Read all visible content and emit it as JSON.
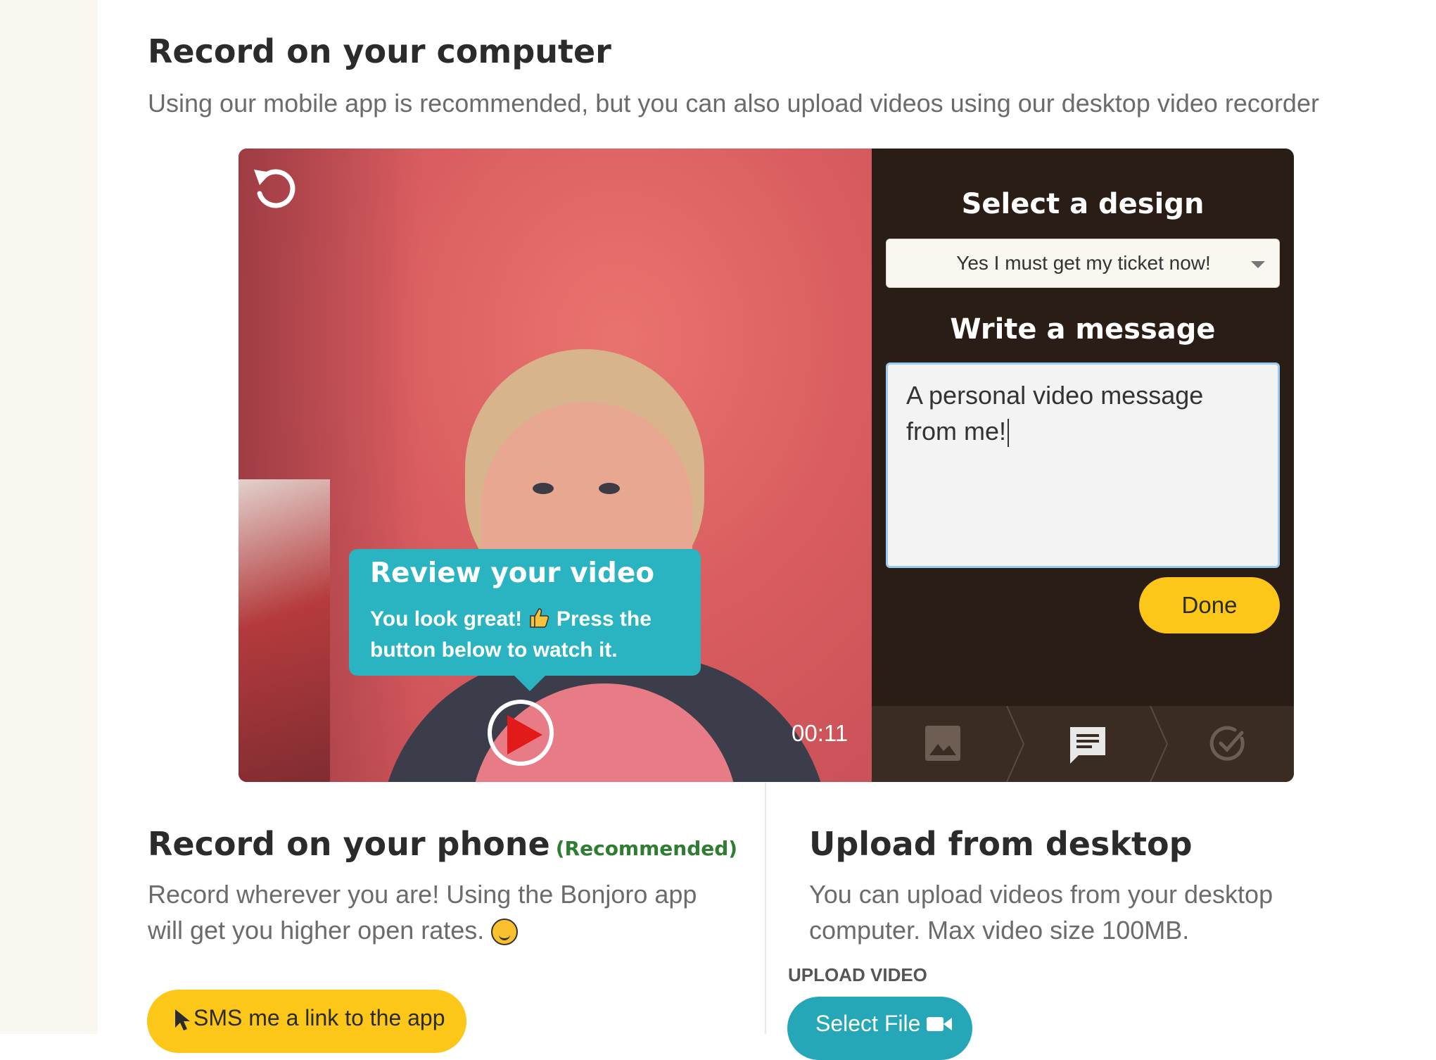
{
  "computer_section": {
    "title": "Record on your computer",
    "subtitle": "Using our mobile app is recommended, but you can also upload videos using our desktop video recorder"
  },
  "recorder": {
    "review_bubble": {
      "title": "Review your video",
      "text_before_icon": "You look great!",
      "thumb_icon": "thumbs-up-icon",
      "text_after_icon": "Press the button below to watch it."
    },
    "timer": "00:11",
    "design": {
      "title": "Select a design",
      "selected": "Yes I must get my ticket now!"
    },
    "message": {
      "title": "Write a message",
      "value": "A personal video message from me!"
    },
    "done_label": "Done",
    "steps": [
      {
        "icon": "image-icon",
        "state": "inactive"
      },
      {
        "icon": "message-icon",
        "state": "active"
      },
      {
        "icon": "check-circle-icon",
        "state": "inactive"
      }
    ]
  },
  "phone_section": {
    "title": "Record on your phone",
    "badge": "(Recommended)",
    "description": "Record wherever you are! Using the Bonjoro app will get you higher open rates.",
    "emoji": "wink-emoji-icon",
    "sms_button": "SMS me a link to the app"
  },
  "upload_section": {
    "title": "Upload from desktop",
    "description": "You can upload videos from your desktop computer. Max video size 100MB.",
    "label": "UPLOAD VIDEO",
    "button": "Select File"
  },
  "colors": {
    "accent_yellow": "#fcc718",
    "accent_teal": "#2ab3c0",
    "panel_dark": "#2a1d16",
    "recommended_green": "#2e7d32"
  }
}
